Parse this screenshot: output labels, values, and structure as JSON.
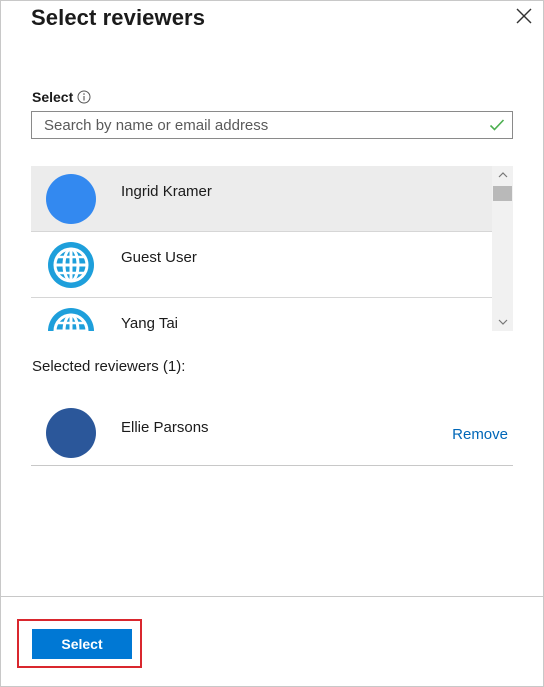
{
  "header": {
    "title": "Select reviewers",
    "close_icon": "close-icon"
  },
  "search": {
    "label": "Select",
    "info_icon": "info-icon",
    "placeholder": "Search by name or email address",
    "value": "",
    "valid_icon": "checkmark-icon"
  },
  "results": {
    "items": [
      {
        "name": "Ingrid Kramer",
        "avatar": "blue-circle",
        "selected": true
      },
      {
        "name": "Guest User",
        "avatar": "globe-icon",
        "selected": false
      },
      {
        "name": "Yang Tai",
        "avatar": "globe-icon",
        "selected": false
      }
    ]
  },
  "selected_reviewers": {
    "label": "Selected reviewers (1):",
    "items": [
      {
        "name": "Ellie Parsons",
        "avatar": "dark-blue-circle",
        "action": "Remove"
      }
    ]
  },
  "footer": {
    "select_label": "Select"
  },
  "colors": {
    "accent": "#0078d4",
    "link": "#0067b8",
    "highlight_border": "#d9272e",
    "avatar_blue": "#3389f0",
    "avatar_dark": "#2b579a",
    "globe": "#1e9fdb",
    "valid": "#4caf50"
  }
}
